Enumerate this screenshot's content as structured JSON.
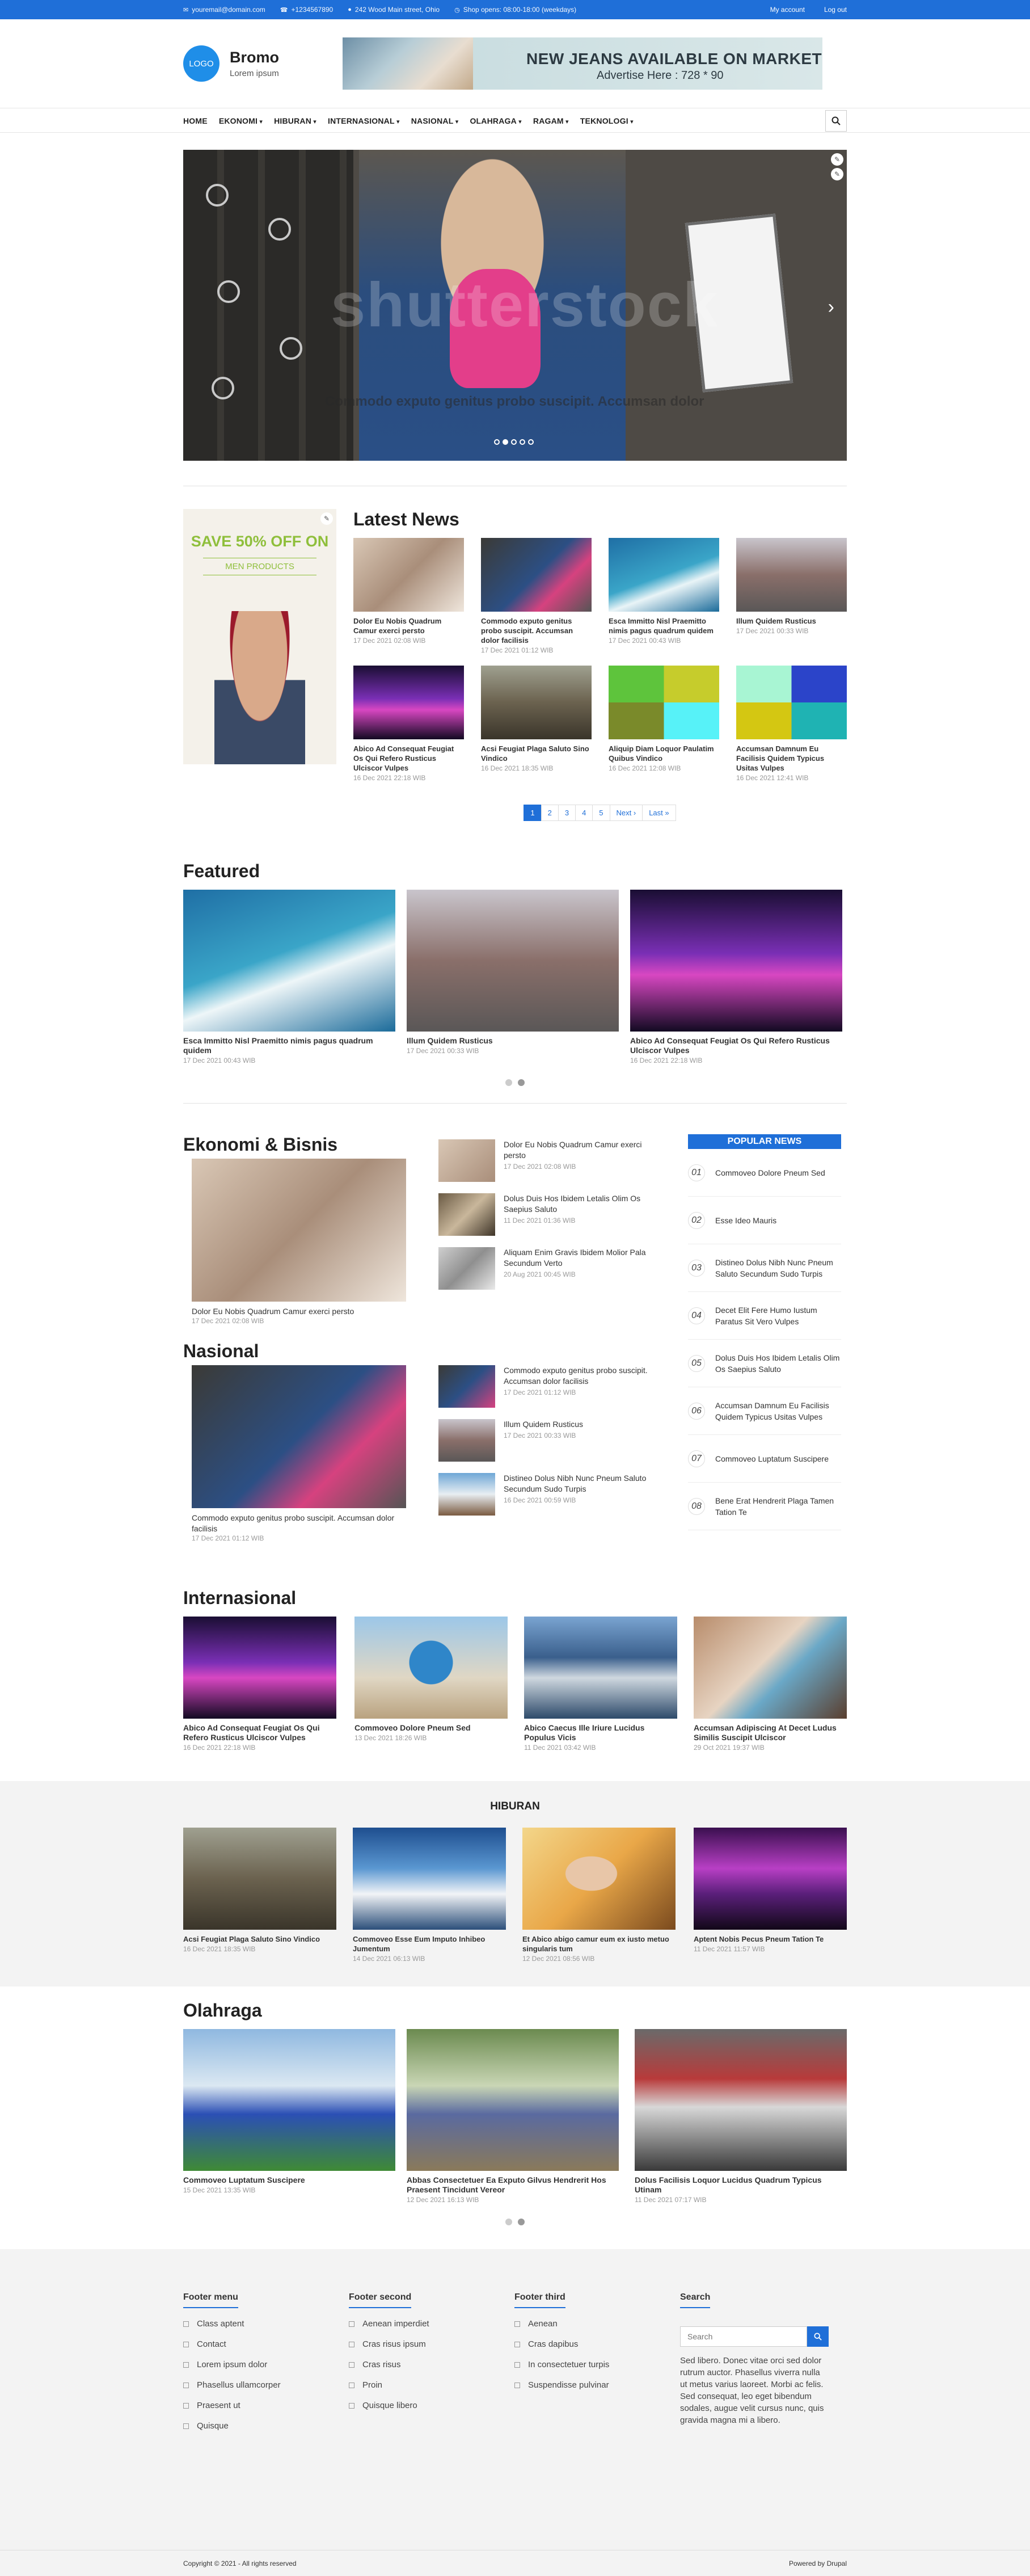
{
  "topbar": {
    "email": "youremail@domain.com",
    "phone": "+1234567890",
    "address": "242 Wood Main street, Ohio",
    "hours": "Shop opens: 08:00-18:00 (weekdays)",
    "my_account": "My account",
    "logout": "Log out"
  },
  "header": {
    "logo": "LOGO",
    "site_name": "Bromo",
    "slogan": "Lorem ipsum",
    "banner_title": "NEW JEANS AVAILABLE ON MARKET",
    "banner_sub": "Advertise Here : 728 * 90"
  },
  "nav": {
    "items": [
      "HOME",
      "EKONOMI",
      "HIBURAN",
      "INTERNASIONAL",
      "NASIONAL",
      "OLAHRAGA",
      "RAGAM",
      "TEKNOLOGI"
    ]
  },
  "slider": {
    "watermark": "shutterstock",
    "caption": "Commodo exputo genitus probo suscipit. Accumsan dolor"
  },
  "ad": {
    "save": "SAVE 50% OFF ON",
    "men": "MEN PRODUCTS"
  },
  "latest": {
    "title": "Latest News",
    "items": [
      {
        "title": "Dolor Eu Nobis Quadrum Camur exerci persto",
        "date": "17 Dec 2021 02:08 WIB"
      },
      {
        "title": "Commodo exputo genitus probo suscipit. Accumsan dolor facilisis",
        "date": "17 Dec 2021 01:12 WIB"
      },
      {
        "title": "Esca Immitto Nisl Praemitto nimis pagus quadrum quidem",
        "date": "17 Dec 2021 00:43 WIB"
      },
      {
        "title": "Illum Quidem Rusticus",
        "date": "17 Dec 2021 00:33 WIB"
      },
      {
        "title": "Abico Ad Consequat Feugiat Os Qui Refero Rusticus Ulciscor Vulpes",
        "date": "16 Dec 2021 22:18 WIB"
      },
      {
        "title": "Acsi Feugiat Plaga Saluto Sino Vindico",
        "date": "16 Dec 2021 18:35 WIB"
      },
      {
        "title": "Aliquip Diam Loquor Paulatim Quibus Vindico",
        "date": "16 Dec 2021 12:08 WIB"
      },
      {
        "title": "Accumsan Damnum Eu Facilisis Quidem Typicus Usitas Vulpes",
        "date": "16 Dec 2021 12:41 WIB"
      }
    ],
    "pager": [
      "1",
      "2",
      "3",
      "4",
      "5",
      "Next ›",
      "Last »"
    ]
  },
  "featured": {
    "title": "Featured",
    "items": [
      {
        "title": "Esca Immitto Nisl Praemitto nimis pagus quadrum quidem",
        "date": "17 Dec 2021 00:43 WIB"
      },
      {
        "title": "Illum Quidem Rusticus",
        "date": "17 Dec 2021 00:33 WIB"
      },
      {
        "title": "Abico Ad Consequat Feugiat Os Qui Refero Rusticus Ulciscor Vulpes",
        "date": "16 Dec 2021 22:18 WIB"
      }
    ]
  },
  "ekonomi": {
    "title": "Ekonomi & Bisnis",
    "big": {
      "title": "Dolor Eu Nobis Quadrum Camur exerci persto",
      "date": "17 Dec 2021 02:08 WIB"
    },
    "list": [
      {
        "title": "Dolor Eu Nobis Quadrum Camur exerci persto",
        "date": "17 Dec 2021 02:08 WIB"
      },
      {
        "title": "Dolus Duis Hos Ibidem Letalis Olim Os Saepius Saluto",
        "date": "11 Dec 2021 01:36 WIB"
      },
      {
        "title": "Aliquam Enim Gravis Ibidem Molior Pala Secundum Verto",
        "date": "20 Aug 2021 00:45 WIB"
      }
    ]
  },
  "nasional": {
    "title": "Nasional",
    "big": {
      "title": "Commodo exputo genitus probo suscipit. Accumsan dolor facilisis",
      "date": "17 Dec 2021 01:12 WIB"
    },
    "list": [
      {
        "title": "Commodo exputo genitus probo suscipit. Accumsan dolor facilisis",
        "date": "17 Dec 2021 01:12 WIB"
      },
      {
        "title": "Illum Quidem Rusticus",
        "date": "17 Dec 2021 00:33 WIB"
      },
      {
        "title": "Distineo Dolus Nibh Nunc Pneum Saluto Secundum Sudo Turpis",
        "date": "16 Dec 2021 00:59 WIB"
      }
    ]
  },
  "popular": {
    "title": "POPULAR NEWS",
    "items": [
      {
        "num": "01",
        "title": "Commoveo Dolore Pneum Sed"
      },
      {
        "num": "02",
        "title": "Esse Ideo Mauris"
      },
      {
        "num": "03",
        "title": "Distineo Dolus Nibh Nunc Pneum Saluto Secundum Sudo Turpis"
      },
      {
        "num": "04",
        "title": "Decet Elit Fere Humo Iustum Paratus Sit Vero Vulpes"
      },
      {
        "num": "05",
        "title": "Dolus Duis Hos Ibidem Letalis Olim Os Saepius Saluto"
      },
      {
        "num": "06",
        "title": "Accumsan Damnum Eu Facilisis Quidem Typicus Usitas Vulpes"
      },
      {
        "num": "07",
        "title": "Commoveo Luptatum Suscipere"
      },
      {
        "num": "08",
        "title": "Bene Erat Hendrerit Plaga Tamen Tation Te"
      }
    ]
  },
  "internasional": {
    "title": "Internasional",
    "items": [
      {
        "title": "Abico Ad Consequat Feugiat Os Qui Refero Rusticus Ulciscor Vulpes",
        "date": "16 Dec 2021 22:18 WIB"
      },
      {
        "title": "Commoveo Dolore Pneum Sed",
        "date": "13 Dec 2021 18:26 WIB"
      },
      {
        "title": "Abico Caecus Ille Iriure Lucidus Populus Vicis",
        "date": "11 Dec 2021 03:42 WIB"
      },
      {
        "title": "Accumsan Adipiscing At Decet Ludus Similis Suscipit Ulciscor",
        "date": "29 Oct 2021 19:37 WIB"
      }
    ]
  },
  "hiburan": {
    "title": "HIBURAN",
    "items": [
      {
        "title": "Acsi Feugiat Plaga Saluto Sino Vindico",
        "date": "16 Dec 2021 18:35 WIB"
      },
      {
        "title": "Commoveo Esse Eum Imputo Inhibeo Jumentum",
        "date": "14 Dec 2021 06:13 WIB"
      },
      {
        "title": "Et Abico abigo camur eum ex iusto metuo singularis tum",
        "date": "12 Dec 2021 08:56 WIB"
      },
      {
        "title": "Aptent Nobis Pecus Pneum Tation Te",
        "date": "11 Dec 2021 11:57 WIB"
      }
    ]
  },
  "olahraga": {
    "title": "Olahraga",
    "items": [
      {
        "title": "Commoveo Luptatum Suscipere",
        "date": "15 Dec 2021 13:35 WIB"
      },
      {
        "title": "Abbas Consectetuer Ea Exputo Gilvus Hendrerit Hos Praesent Tincidunt Vereor",
        "date": "12 Dec 2021 16:13 WIB"
      },
      {
        "title": "Dolus Facilisis Loquor Lucidus Quadrum Typicus Utinam",
        "date": "11 Dec 2021 07:17 WIB"
      }
    ]
  },
  "footer": {
    "col1": {
      "title": "Footer menu",
      "items": [
        "Class aptent",
        "Contact",
        "Lorem ipsum dolor",
        "Phasellus ullamcorper",
        "Praesent ut",
        "Quisque"
      ]
    },
    "col2": {
      "title": "Footer second",
      "items": [
        "Aenean imperdiet",
        "Cras risus ipsum",
        "Cras risus",
        "Proin",
        "Quisque libero"
      ]
    },
    "col3": {
      "title": "Footer third",
      "items": [
        "Aenean",
        "Cras dapibus",
        "In consectetuer turpis",
        "Suspendisse pulvinar"
      ]
    },
    "search": {
      "title": "Search",
      "placeholder": "Search",
      "desc": "Sed libero. Donec vitae orci sed dolor rutrum auctor. Phasellus viverra nulla ut metus varius laoreet. Morbi ac felis. Sed consequat, leo eget bibendum sodales, augue velit cursus nunc, quis gravida magna mi a libero."
    }
  },
  "bottom": {
    "copyright": "Copyright © 2021 - All rights reserved",
    "powered": "Powered by Drupal"
  }
}
